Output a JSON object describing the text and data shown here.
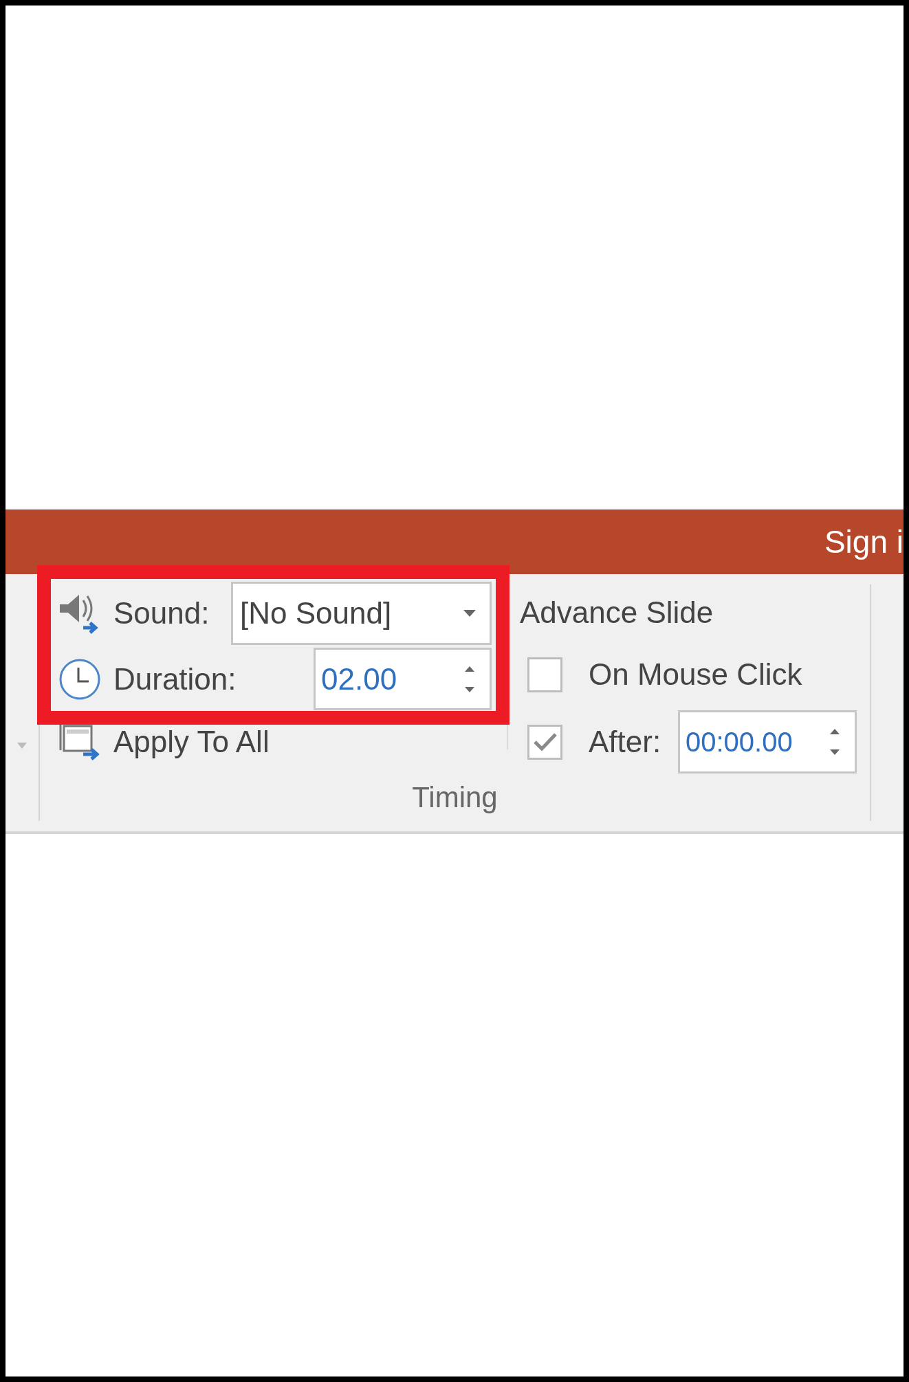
{
  "title_bar": {
    "account_link": "Sign i"
  },
  "timing_group": {
    "label": "Timing",
    "sound": {
      "label": "Sound:",
      "value": "[No Sound]"
    },
    "duration": {
      "label": "Duration:",
      "value": "02.00"
    },
    "apply_to_all": {
      "label": "Apply To All"
    }
  },
  "advance_slide": {
    "heading": "Advance Slide",
    "options": [
      {
        "kind": "checkbox",
        "label": "On Mouse Click",
        "checked": false
      },
      {
        "kind": "timed",
        "label": "After:",
        "checked": true,
        "value": "00:00.00"
      }
    ]
  },
  "annotation": {
    "kind": "highlight-frame"
  }
}
